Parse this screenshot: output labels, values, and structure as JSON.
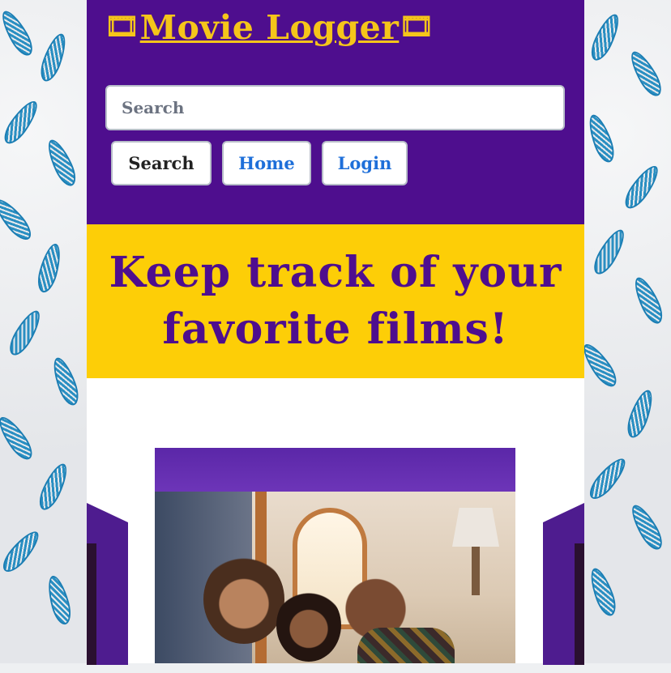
{
  "header": {
    "film_icon": "🎞",
    "title": "Movie Logger"
  },
  "search": {
    "placeholder": "Search",
    "button_label": "Search"
  },
  "nav": {
    "home_label": "Home",
    "login_label": "Login"
  },
  "banner": {
    "headline": "Keep track of your favorite films!"
  },
  "colors": {
    "header_purple": "#4e0e8e",
    "accent_yellow": "#fdce07",
    "link_blue": "#1e6fd9"
  },
  "carousel": {
    "image": "couple-and-child-watching-movie-photo"
  }
}
